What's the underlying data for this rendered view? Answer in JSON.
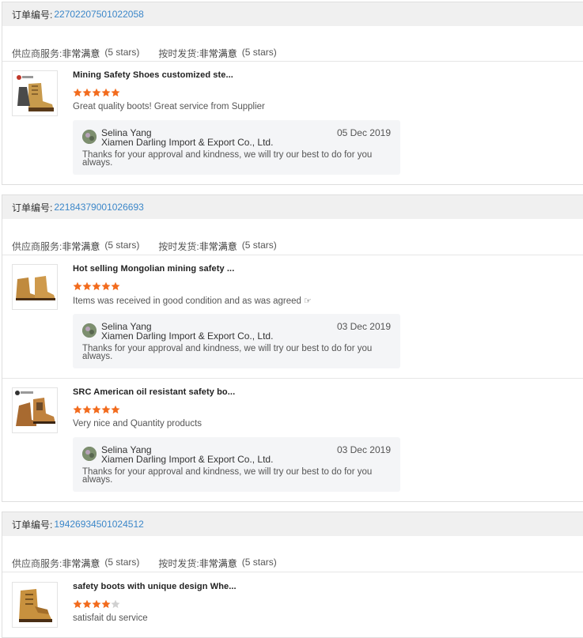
{
  "orders": [
    {
      "label": "订单编号:",
      "number": "22702207501022058",
      "supplier_label": "供应商服务:",
      "supplier_value": "非常满意",
      "supplier_stars": "(5 stars)",
      "shipping_label": "按时发货:",
      "shipping_value": "非常满意",
      "shipping_stars": "(5 stars)",
      "items": [
        {
          "title": "Mining Safety Shoes customized ste...",
          "rating": 5,
          "comment": "Great quality boots! Great service from Supplier",
          "reply": {
            "name": "Selina Yang",
            "company": "Xiamen Darling Import & Export Co., Ltd.",
            "date": "05 Dec 2019",
            "text": "Thanks for your approval and kindness, we will try our best to do for you always."
          }
        }
      ]
    },
    {
      "label": "订单编号:",
      "number": "22184379001026693",
      "supplier_label": "供应商服务:",
      "supplier_value": "非常满意",
      "supplier_stars": "(5 stars)",
      "shipping_label": "按时发货:",
      "shipping_value": "非常满意",
      "shipping_stars": "(5 stars)",
      "items": [
        {
          "title": "Hot selling Mongolian mining safety ...",
          "rating": 5,
          "comment": "Items was received in good condition and as was agreed",
          "comment_icon": "pointing-hand-icon",
          "reply": {
            "name": "Selina Yang",
            "company": "Xiamen Darling Import & Export Co., Ltd.",
            "date": "03 Dec 2019",
            "text": "Thanks for your approval and kindness, we will try our best to do for you always."
          }
        },
        {
          "title": "SRC American oil resistant safety bo...",
          "rating": 5,
          "comment": "Very nice and Quantity products",
          "reply": {
            "name": "Selina Yang",
            "company": "Xiamen Darling Import & Export Co., Ltd.",
            "date": "03 Dec 2019",
            "text": "Thanks for your approval and kindness, we will try our best to do for you always."
          }
        }
      ]
    },
    {
      "label": "订单编号:",
      "number": "19426934501024512",
      "supplier_label": "供应商服务:",
      "supplier_value": "非常满意",
      "supplier_stars": "(5 stars)",
      "shipping_label": "按时发货:",
      "shipping_value": "非常满意",
      "shipping_stars": "(5 stars)",
      "items": [
        {
          "title": "safety boots with unique design Whe...",
          "rating": 4,
          "comment": "satisfait du service"
        }
      ]
    }
  ],
  "colors": {
    "star_filled": "#f26b1d",
    "star_empty": "#d0d0d0",
    "order_link": "#3c87c9",
    "header_bg": "#f0f0f0",
    "reply_bg": "#f4f5f7"
  }
}
